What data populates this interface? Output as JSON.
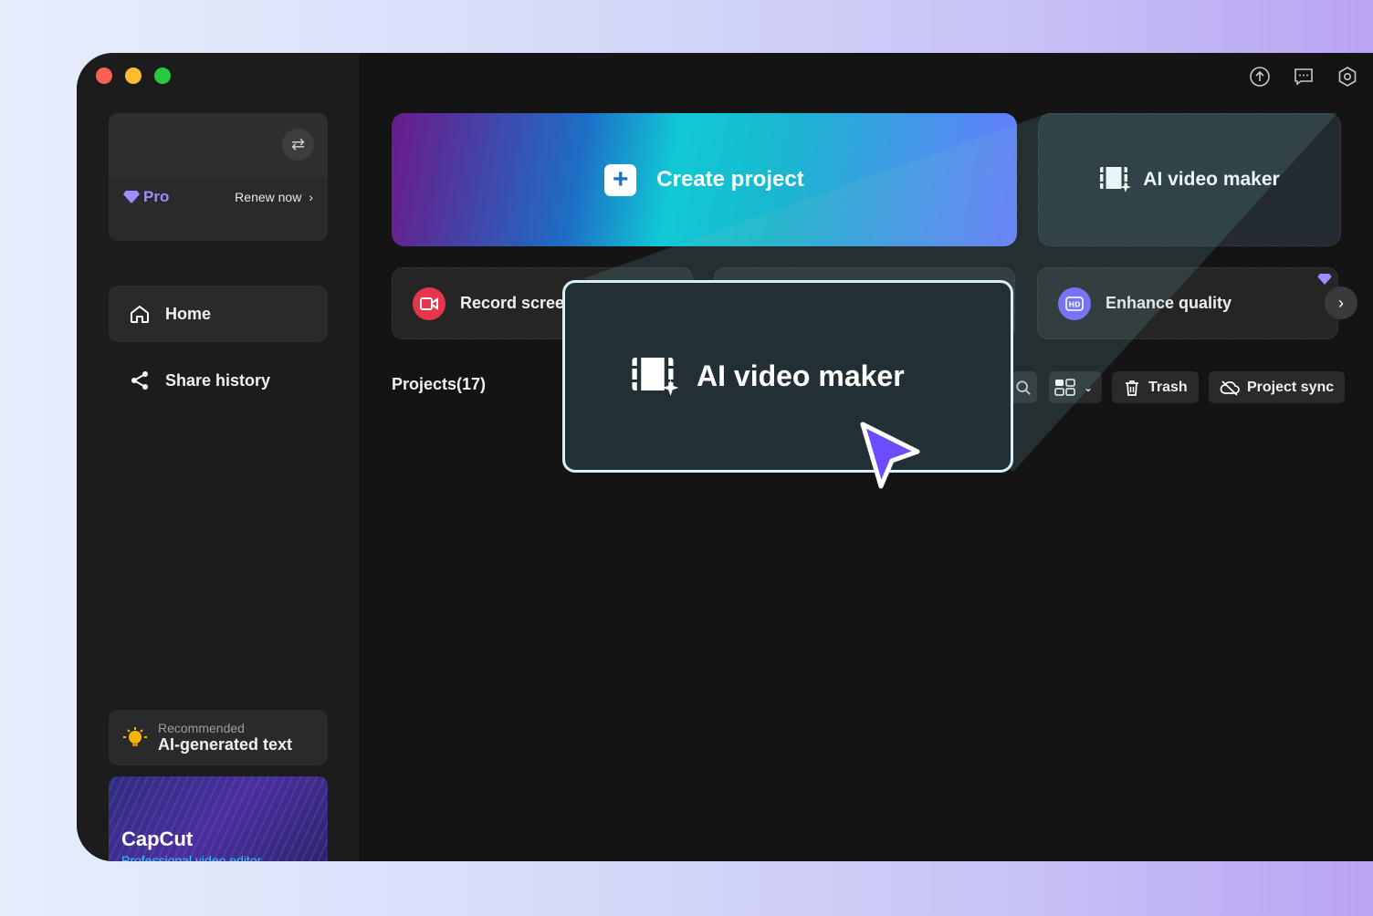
{
  "sidebar": {
    "account": {
      "plan": "Pro",
      "renew_label": "Renew now"
    },
    "nav": [
      {
        "label": "Home"
      },
      {
        "label": "Share history"
      }
    ],
    "recommended": {
      "caption": "Recommended",
      "title": "AI-generated text"
    },
    "promo": {
      "title": "CapCut",
      "subtitle": "Professional video editor"
    }
  },
  "main": {
    "create_label": "Create project",
    "ai_video_label": "AI video maker",
    "tools": [
      {
        "label": "Record screen",
        "icon": "record-icon"
      },
      {
        "label": "Enhance quality",
        "icon": "hd-icon"
      }
    ],
    "projects_title": "Projects(17)",
    "trash_label": "Trash",
    "sync_label": "Project sync"
  },
  "callout": {
    "label": "AI video maker"
  },
  "colors": {
    "accent": "#7b5cff",
    "record": "#e5364b",
    "enhance": "#7a63ff"
  }
}
